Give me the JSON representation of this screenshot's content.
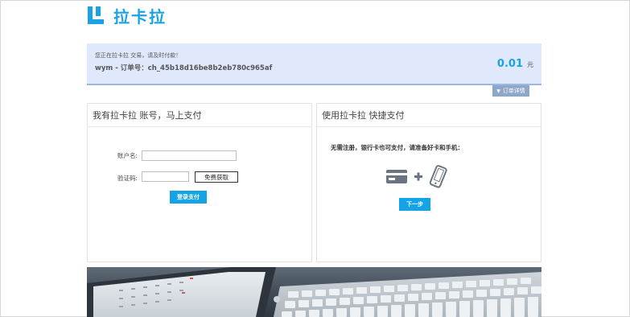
{
  "brand": {
    "name": "拉卡拉",
    "color": "#1aa3e4"
  },
  "order": {
    "notice": "您正在拉卡拉 交易，请及时付款！",
    "order_line": "wym - 订单号：ch_45b18d16be8b2eb780c965af",
    "amount": "0.01",
    "currency": "元",
    "detail_label": "订单详情"
  },
  "account_panel": {
    "title": "我有拉卡拉 账号，马上支付",
    "account_label": "账户名:",
    "account_value": "",
    "code_label": "验证码:",
    "code_value": "",
    "get_code_label": "免费获取",
    "login_pay_label": "登录支付"
  },
  "quick_panel": {
    "title": "使用拉卡拉 快捷支付",
    "note": "无需注册，银行卡也可支付，请准备好卡和手机：",
    "next_label": "下一步",
    "icons": [
      "bank-card-icon",
      "plus-icon",
      "mobile-phone-icon"
    ]
  },
  "colors": {
    "accent": "#13a3e6",
    "banner_bg": "#dfe9fb",
    "detail_btn": "#8ea6c9"
  }
}
